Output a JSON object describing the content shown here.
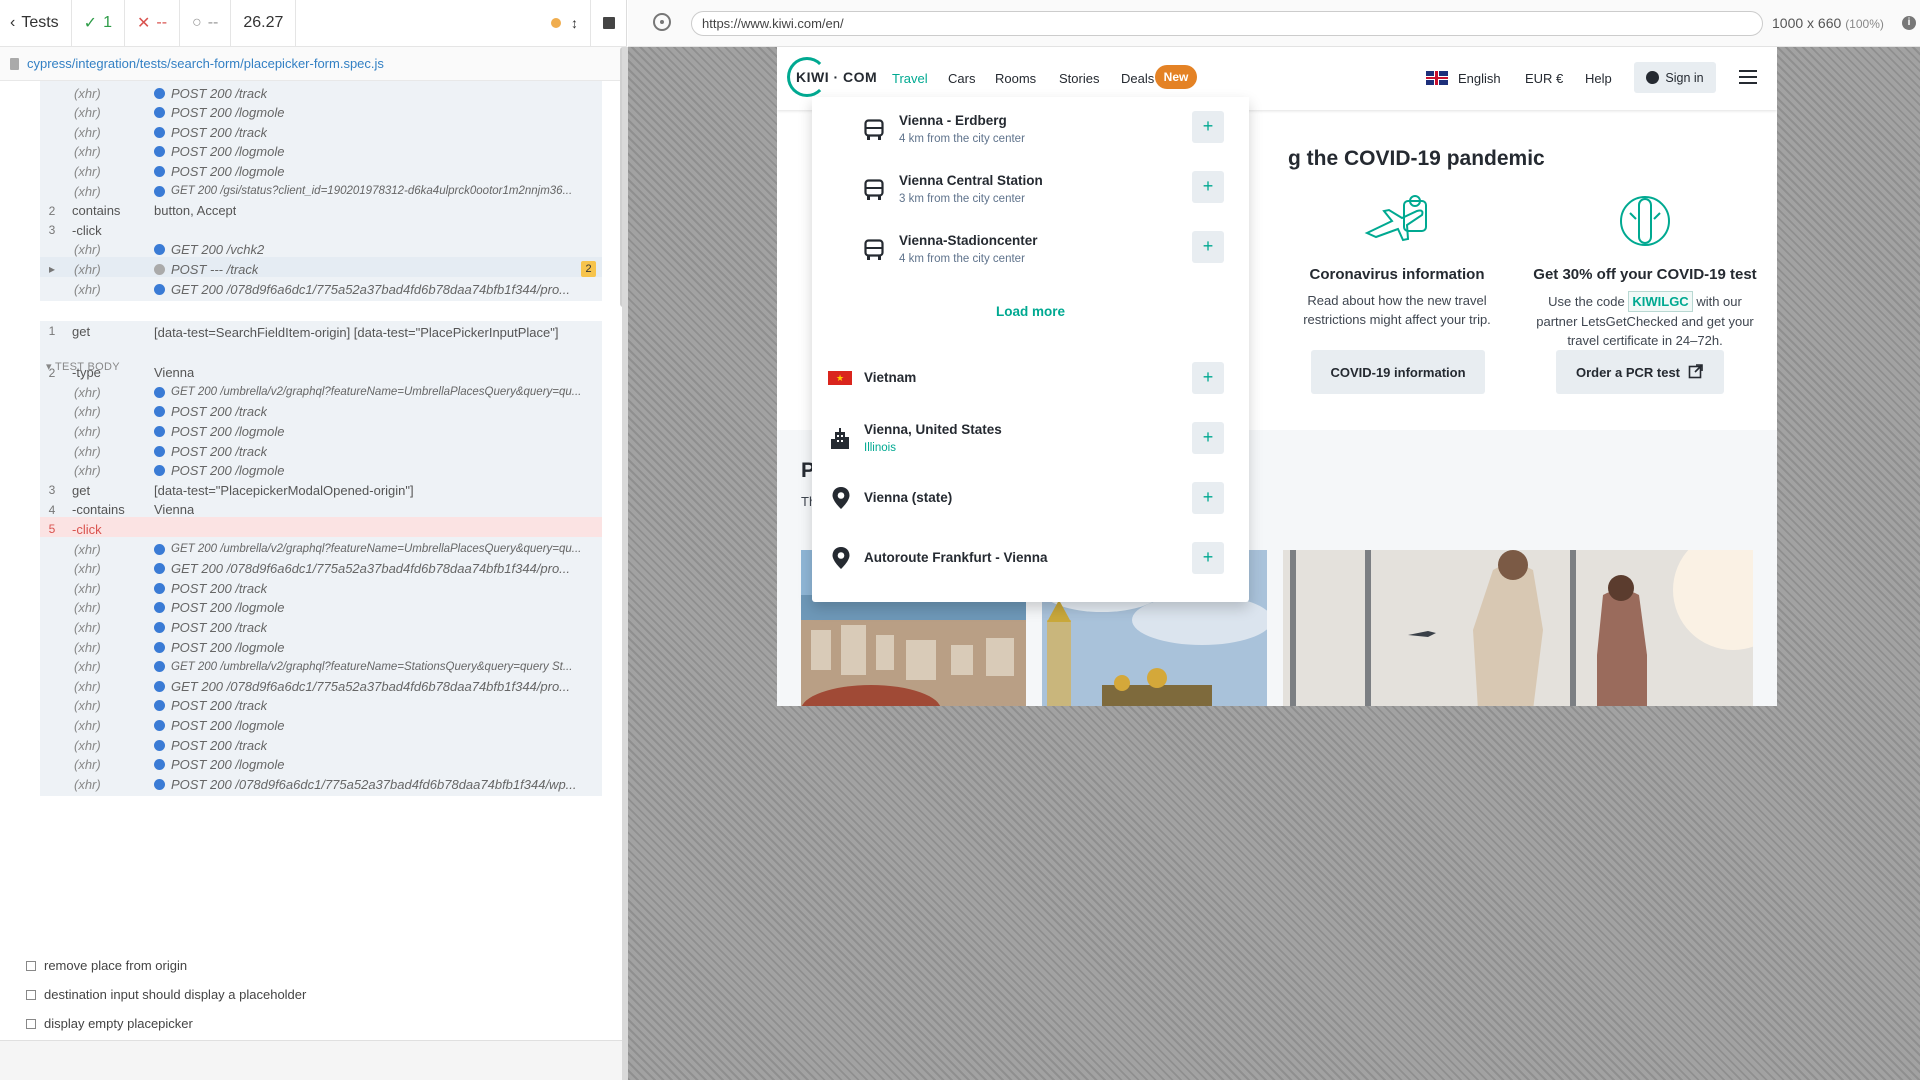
{
  "reporter": {
    "tests_label": "Tests",
    "passed": "1",
    "failed": "--",
    "pending": "--",
    "duration": "26.27",
    "spec_path": "cypress/integration/tests/search-form/placepicker-form.spec.js",
    "test_body_label": "TEST BODY",
    "commands": [
      {
        "num": "",
        "name": "(xhr)",
        "msg": "POST 200 /track",
        "type": "xhr"
      },
      {
        "num": "",
        "name": "(xhr)",
        "msg": "POST 200 /logmole",
        "type": "xhr"
      },
      {
        "num": "",
        "name": "(xhr)",
        "msg": "POST 200 /track",
        "type": "xhr"
      },
      {
        "num": "",
        "name": "(xhr)",
        "msg": "POST 200 /logmole",
        "type": "xhr"
      },
      {
        "num": "",
        "name": "(xhr)",
        "msg": "POST 200 /logmole",
        "type": "xhr"
      },
      {
        "num": "",
        "name": "(xhr)",
        "msg": "GET 200 /gsi/status?client_id=190201978312-d6ka4ulprck0ootor1m2nnjm36...",
        "type": "xhr-small"
      },
      {
        "num": "2",
        "name": "contains",
        "msg": "button, Accept",
        "type": "cmd"
      },
      {
        "num": "3",
        "name": "-click",
        "msg": "",
        "type": "cmd"
      },
      {
        "num": "",
        "name": "(xhr)",
        "msg": "GET 200 /vchk2",
        "type": "xhr"
      },
      {
        "num": "",
        "name": "(xhr)",
        "msg": "POST --- /track",
        "type": "xhr-pending",
        "badge": "2"
      },
      {
        "num": "",
        "name": "(xhr)",
        "msg": "GET 200 /078d9f6a6dc1/775a52a37bad4fd6b78daa74bfb1f344/pro...",
        "type": "xhr"
      },
      {
        "num": "1",
        "name": "get",
        "msg": "[data-test=SearchFieldItem-origin] [data-test=\"PlacePickerInputPlace\"]",
        "type": "cmd-tall"
      },
      {
        "num": "2",
        "name": "-type",
        "msg": "Vienna",
        "type": "cmd"
      },
      {
        "num": "",
        "name": "(xhr)",
        "msg": "GET 200 /umbrella/v2/graphql?featureName=UmbrellaPlacesQuery&query=qu...",
        "type": "xhr-small"
      },
      {
        "num": "",
        "name": "(xhr)",
        "msg": "POST 200 /track",
        "type": "xhr"
      },
      {
        "num": "",
        "name": "(xhr)",
        "msg": "POST 200 /logmole",
        "type": "xhr"
      },
      {
        "num": "",
        "name": "(xhr)",
        "msg": "POST 200 /track",
        "type": "xhr"
      },
      {
        "num": "",
        "name": "(xhr)",
        "msg": "POST 200 /logmole",
        "type": "xhr"
      },
      {
        "num": "3",
        "name": "get",
        "msg": "[data-test=\"PlacepickerModalOpened-origin\"]",
        "type": "cmd"
      },
      {
        "num": "4",
        "name": "-contains",
        "msg": "Vienna",
        "type": "cmd"
      },
      {
        "num": "5",
        "name": "-click",
        "msg": "",
        "type": "cmd-err"
      },
      {
        "num": "",
        "name": "(xhr)",
        "msg": "GET 200 /umbrella/v2/graphql?featureName=UmbrellaPlacesQuery&query=qu...",
        "type": "xhr-small"
      },
      {
        "num": "",
        "name": "(xhr)",
        "msg": "GET 200 /078d9f6a6dc1/775a52a37bad4fd6b78daa74bfb1f344/pro...",
        "type": "xhr"
      },
      {
        "num": "",
        "name": "(xhr)",
        "msg": "POST 200 /track",
        "type": "xhr"
      },
      {
        "num": "",
        "name": "(xhr)",
        "msg": "POST 200 /logmole",
        "type": "xhr"
      },
      {
        "num": "",
        "name": "(xhr)",
        "msg": "POST 200 /track",
        "type": "xhr"
      },
      {
        "num": "",
        "name": "(xhr)",
        "msg": "POST 200 /logmole",
        "type": "xhr"
      },
      {
        "num": "",
        "name": "(xhr)",
        "msg": "GET 200 /umbrella/v2/graphql?featureName=StationsQuery&query=query St...",
        "type": "xhr-small"
      },
      {
        "num": "",
        "name": "(xhr)",
        "msg": "GET 200 /078d9f6a6dc1/775a52a37bad4fd6b78daa74bfb1f344/pro...",
        "type": "xhr"
      },
      {
        "num": "",
        "name": "(xhr)",
        "msg": "POST 200 /track",
        "type": "xhr"
      },
      {
        "num": "",
        "name": "(xhr)",
        "msg": "POST 200 /logmole",
        "type": "xhr"
      },
      {
        "num": "",
        "name": "(xhr)",
        "msg": "POST 200 /track",
        "type": "xhr"
      },
      {
        "num": "",
        "name": "(xhr)",
        "msg": "POST 200 /logmole",
        "type": "xhr"
      },
      {
        "num": "",
        "name": "(xhr)",
        "msg": "POST 200 /078d9f6a6dc1/775a52a37bad4fd6b78daa74bfb1f344/wp...",
        "type": "xhr"
      }
    ],
    "pending_tests": [
      "remove place from origin",
      "destination input should display a placeholder",
      "display empty placepicker"
    ]
  },
  "aut": {
    "url": "https://www.kiwi.com/en/",
    "viewport": "1000 x 660",
    "zoom": "(100%)"
  },
  "kiwi": {
    "logo": "KIWI · COM",
    "nav": [
      "Travel",
      "Cars",
      "Rooms",
      "Stories",
      "Deals"
    ],
    "new_badge": "New",
    "language": "English",
    "currency": "EUR €",
    "help": "Help",
    "sign_in": "Sign in",
    "covid_title": "g the COVID-19 pandemic",
    "covid_info_title": "Coronavirus information",
    "covid_info_text": "Read about how the new travel restrictions might affect your trip.",
    "covid_info_button": "COVID-19 information",
    "pcr_title": "Get 30% off your COVID-19 test",
    "pcr_text_1": "Use the code",
    "pcr_code": "KIWILGC",
    "pcr_text_2": "with our partner LetsGetChecked and get your travel certificate in 24–72h.",
    "pcr_button": "Order a PCR test",
    "popular_title": "P",
    "popular_sub": "Th",
    "dropdown": {
      "stations": [
        {
          "title": "Vienna - Erdberg",
          "sub": "4 km from the city center"
        },
        {
          "title": "Vienna Central Station",
          "sub": "3 km from the city center"
        },
        {
          "title": "Vienna-Stadioncenter",
          "sub": "4 km from the city center"
        }
      ],
      "load_more": "Load more",
      "places": [
        {
          "title": "Vietnam",
          "sub": "",
          "icon": "flag-vietnam-icon"
        },
        {
          "title": "Vienna, United States",
          "sub": "Illinois",
          "icon": "city-icon"
        },
        {
          "title": "Vienna (state)",
          "sub": "",
          "icon": "location-pin-icon"
        },
        {
          "title": "Autoroute Frankfurt - Vienna",
          "sub": "",
          "icon": "location-pin-icon"
        }
      ]
    }
  },
  "colors": {
    "accent": "#00a991",
    "pass": "#2e9c48",
    "fail": "#d9534f",
    "badge": "#e48225"
  }
}
